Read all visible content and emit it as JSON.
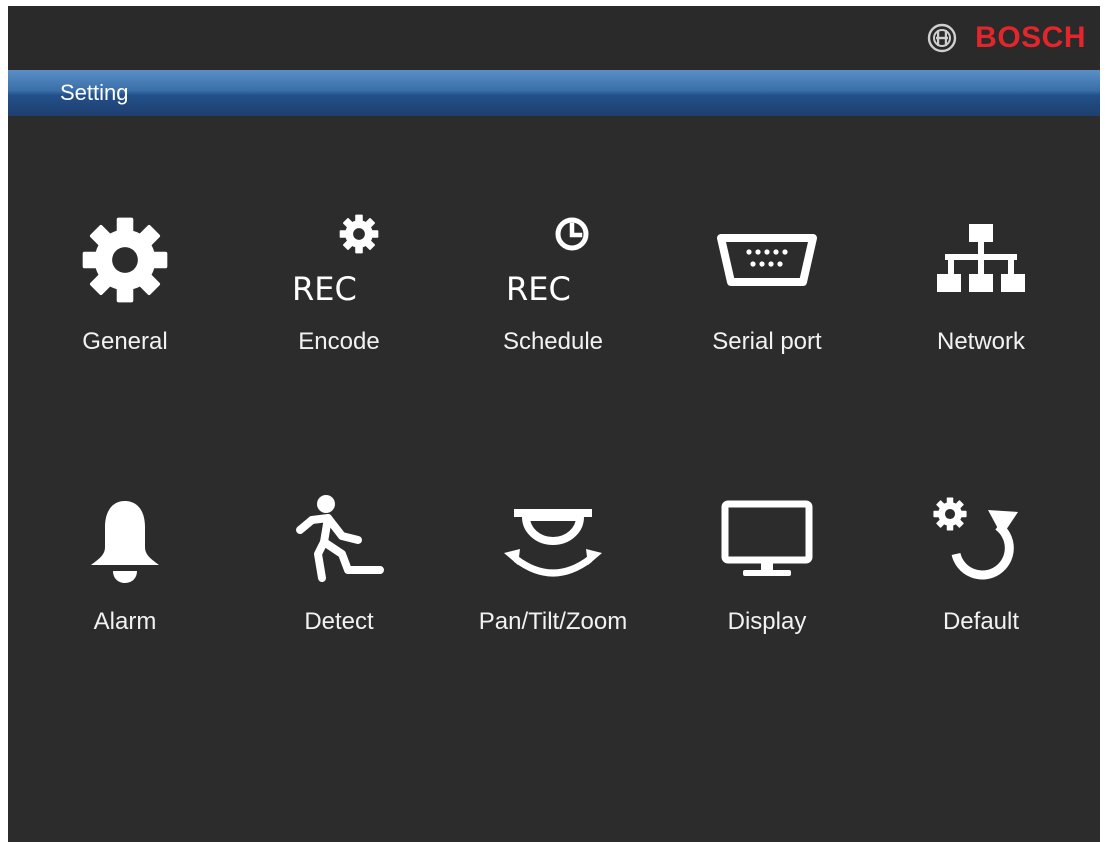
{
  "brand": {
    "name": "BOSCH",
    "color": "#e2262b"
  },
  "window": {
    "title": "Setting"
  },
  "menu": {
    "items": [
      {
        "label": "General",
        "icon": "gear-icon"
      },
      {
        "label": "Encode",
        "icon": "rec-gear-icon",
        "icon_text": "REC"
      },
      {
        "label": "Schedule",
        "icon": "rec-clock-icon",
        "icon_text": "REC"
      },
      {
        "label": "Serial port",
        "icon": "serial-port-icon"
      },
      {
        "label": "Network",
        "icon": "network-icon"
      },
      {
        "label": "Alarm",
        "icon": "bell-icon"
      },
      {
        "label": "Detect",
        "icon": "running-person-icon"
      },
      {
        "label": "Pan/Tilt/Zoom",
        "icon": "ptz-icon"
      },
      {
        "label": "Display",
        "icon": "monitor-icon"
      },
      {
        "label": "Default",
        "icon": "reset-gear-icon"
      }
    ]
  },
  "colors": {
    "background": "#2c2c2c",
    "titlebar": "#2f609a",
    "icon": "#ffffff",
    "text": "#f2f2f2"
  }
}
